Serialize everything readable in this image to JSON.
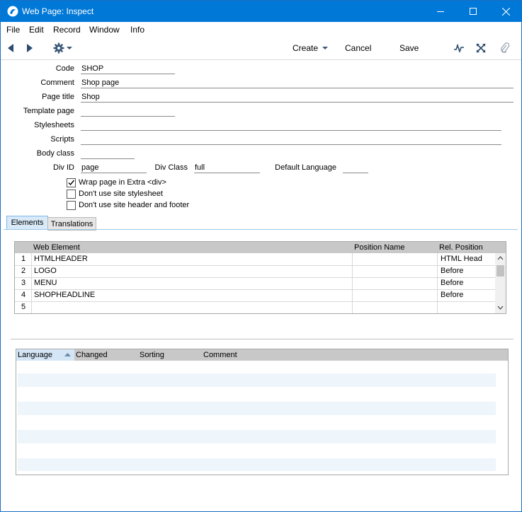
{
  "window": {
    "title": "Web Page: Inspect",
    "minimize_glyph": "—",
    "maximize_glyph": "☐",
    "close_glyph": "✕"
  },
  "menu": [
    "File",
    "Edit",
    "Record",
    "Window",
    "Info"
  ],
  "toolbar": {
    "create_label": "Create",
    "cancel_label": "Cancel",
    "save_label": "Save"
  },
  "form": {
    "code_label": "Code",
    "code_value": "SHOP",
    "comment_label": "Comment",
    "comment_value": "Shop page",
    "page_title_label": "Page title",
    "page_title_value": "Shop",
    "template_page_label": "Template page",
    "template_page_value": "",
    "stylesheets_label": "Stylesheets",
    "stylesheets_value": "",
    "scripts_label": "Scripts",
    "scripts_value": "",
    "body_class_label": "Body class",
    "body_class_value": "",
    "div_id_label": "Div ID",
    "div_id_value": "page",
    "div_class_label": "Div Class",
    "div_class_value": "full",
    "default_language_label": "Default Language",
    "default_language_value": "",
    "wrap_label": "Wrap page in Extra <div>",
    "wrap_checked": true,
    "no_stylesheet_label": "Don't use site stylesheet",
    "no_stylesheet_checked": false,
    "no_header_footer_label": "Don't use site header and footer",
    "no_header_footer_checked": false
  },
  "tabs": [
    {
      "label": "Elements",
      "active": true
    },
    {
      "label": "Translations",
      "active": false
    }
  ],
  "elements_grid": {
    "headers": [
      "Web Element",
      "Position Name",
      "Rel. Position"
    ],
    "rows": [
      {
        "num": "1",
        "element": "HTMLHEADER",
        "position_name": "",
        "rel_position": "HTML Head"
      },
      {
        "num": "2",
        "element": "LOGO",
        "position_name": "",
        "rel_position": "Before"
      },
      {
        "num": "3",
        "element": "MENU",
        "position_name": "",
        "rel_position": "Before"
      },
      {
        "num": "4",
        "element": "SHOPHEADLINE",
        "position_name": "",
        "rel_position": "Before"
      },
      {
        "num": "5",
        "element": "",
        "position_name": "",
        "rel_position": ""
      }
    ]
  },
  "translations_list": {
    "headers": [
      "Language",
      "Changed",
      "Sorting",
      "Comment"
    ],
    "sorted_column": "Language"
  },
  "colors": {
    "titlebar": "#0078d7",
    "header_bg": "#c8c8c8",
    "stripe": "#eef5fb"
  }
}
